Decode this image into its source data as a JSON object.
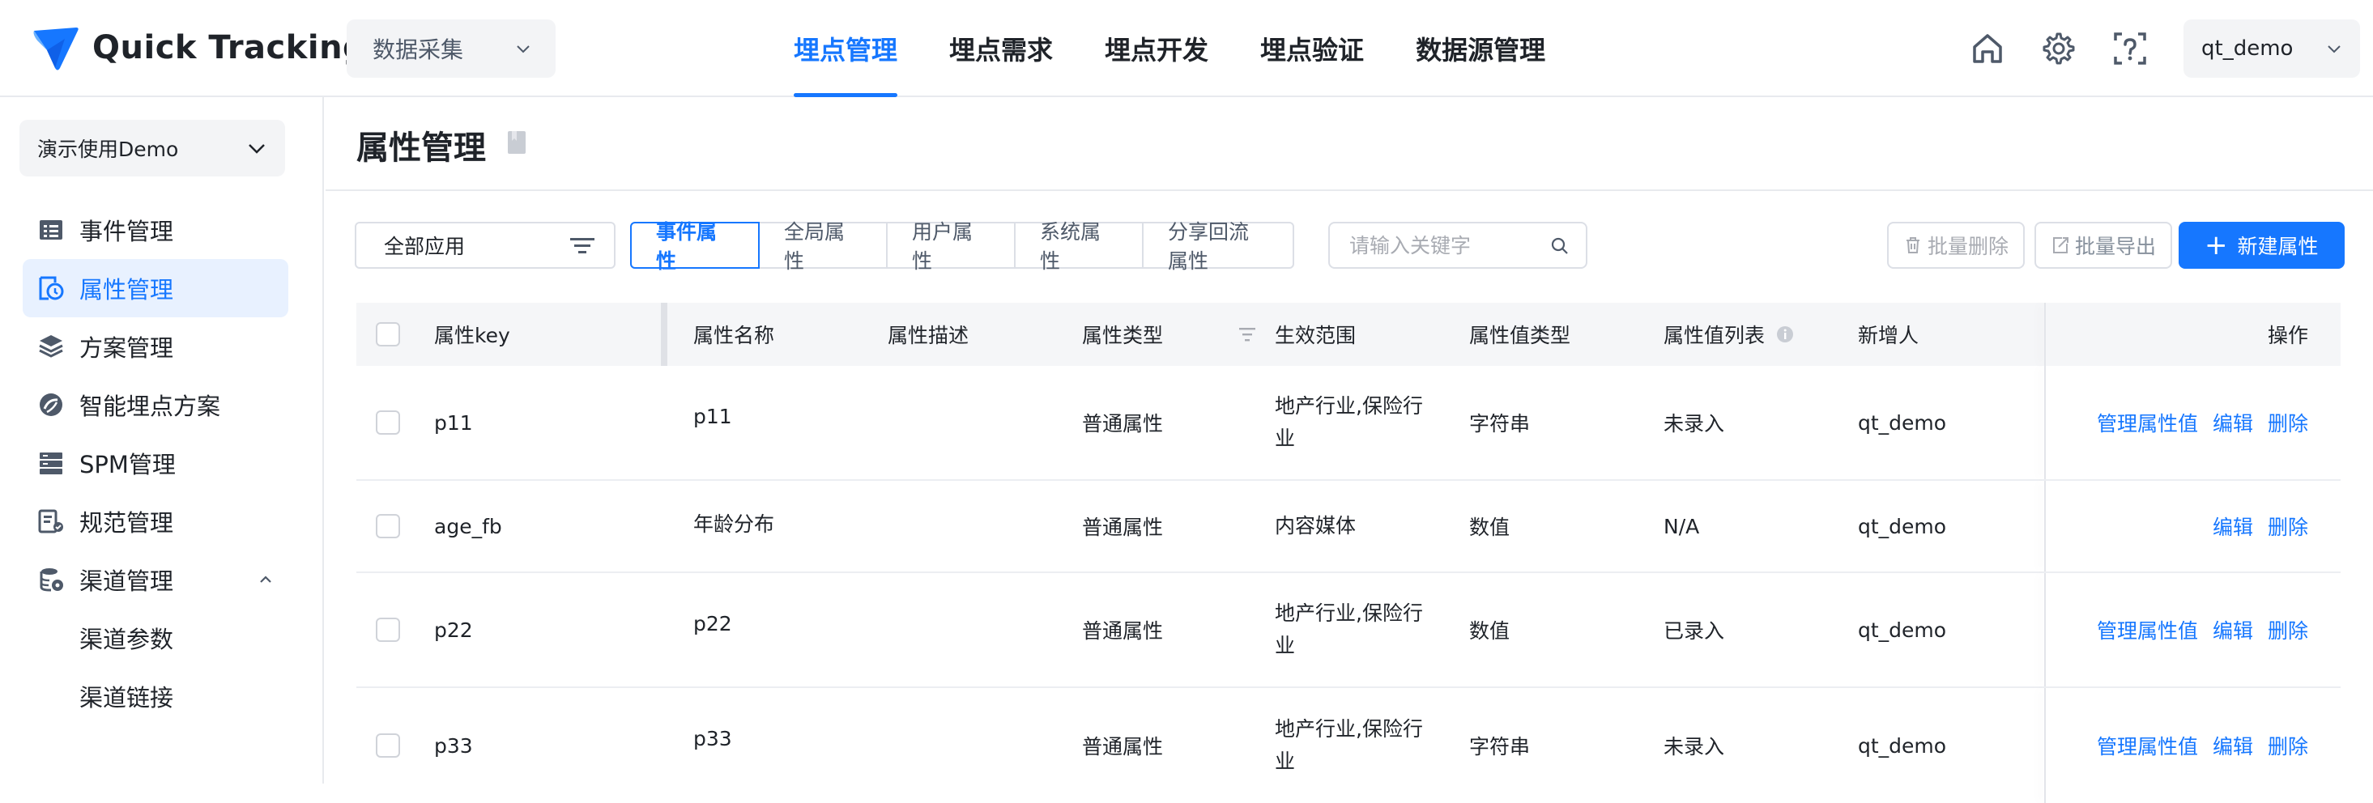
{
  "brand": {
    "name": "Quick Tracking"
  },
  "header": {
    "app_select": "数据采集",
    "nav": [
      "埋点管理",
      "埋点需求",
      "埋点开发",
      "埋点验证",
      "数据源管理"
    ],
    "active_nav": 0,
    "user": "qt_demo",
    "icons": [
      "home-icon",
      "gear-icon",
      "help-icon"
    ]
  },
  "sidebar": {
    "project": "演示使用Demo",
    "items": [
      {
        "label": "事件管理",
        "icon": "event-list-icon"
      },
      {
        "label": "属性管理",
        "icon": "property-icon",
        "active": true
      },
      {
        "label": "方案管理",
        "icon": "layers-icon"
      },
      {
        "label": "智能埋点方案",
        "icon": "smart-icon"
      },
      {
        "label": "SPM管理",
        "icon": "server-icon"
      },
      {
        "label": "规范管理",
        "icon": "spec-icon"
      },
      {
        "label": "渠道管理",
        "icon": "channel-icon",
        "expanded": true
      }
    ],
    "sub_items": [
      "渠道参数",
      "渠道链接"
    ]
  },
  "page": {
    "title": "属性管理"
  },
  "toolbar": {
    "app_filter": "全部应用",
    "tabs": [
      "事件属性",
      "全局属性",
      "用户属性",
      "系统属性",
      "分享回流属性"
    ],
    "active_tab": 0,
    "search_placeholder": "请输入关键字",
    "batch_delete": "批量删除",
    "batch_export": "批量导出",
    "new_property": "新建属性"
  },
  "table": {
    "headers": {
      "key": "属性key",
      "name": "属性名称",
      "desc": "属性描述",
      "type": "属性类型",
      "scope": "生效范围",
      "value_type": "属性值类型",
      "value_list": "属性值列表",
      "creator": "新增人",
      "ops": "操作"
    },
    "ops_labels": {
      "manage": "管理属性值",
      "edit": "编辑",
      "delete": "删除"
    },
    "rows": [
      {
        "key": "p11",
        "name": "p11",
        "desc": "",
        "type": "普通属性",
        "scope": "地产行业,保险行业",
        "value_type": "字符串",
        "value_list": "未录入",
        "creator": "qt_demo",
        "manage": true
      },
      {
        "key": "age_fb",
        "name": "年龄分布",
        "desc": "",
        "type": "普通属性",
        "scope": "内容媒体",
        "value_type": "数值",
        "value_list": "N/A",
        "creator": "qt_demo",
        "manage": false
      },
      {
        "key": "p22",
        "name": "p22",
        "desc": "",
        "type": "普通属性",
        "scope": "地产行业,保险行业",
        "value_type": "数值",
        "value_list": "已录入",
        "creator": "qt_demo",
        "manage": true
      },
      {
        "key": "p33",
        "name": "p33",
        "desc": "",
        "type": "普通属性",
        "scope": "地产行业,保险行业",
        "value_type": "字符串",
        "value_list": "未录入",
        "creator": "qt_demo",
        "manage": true
      }
    ]
  }
}
